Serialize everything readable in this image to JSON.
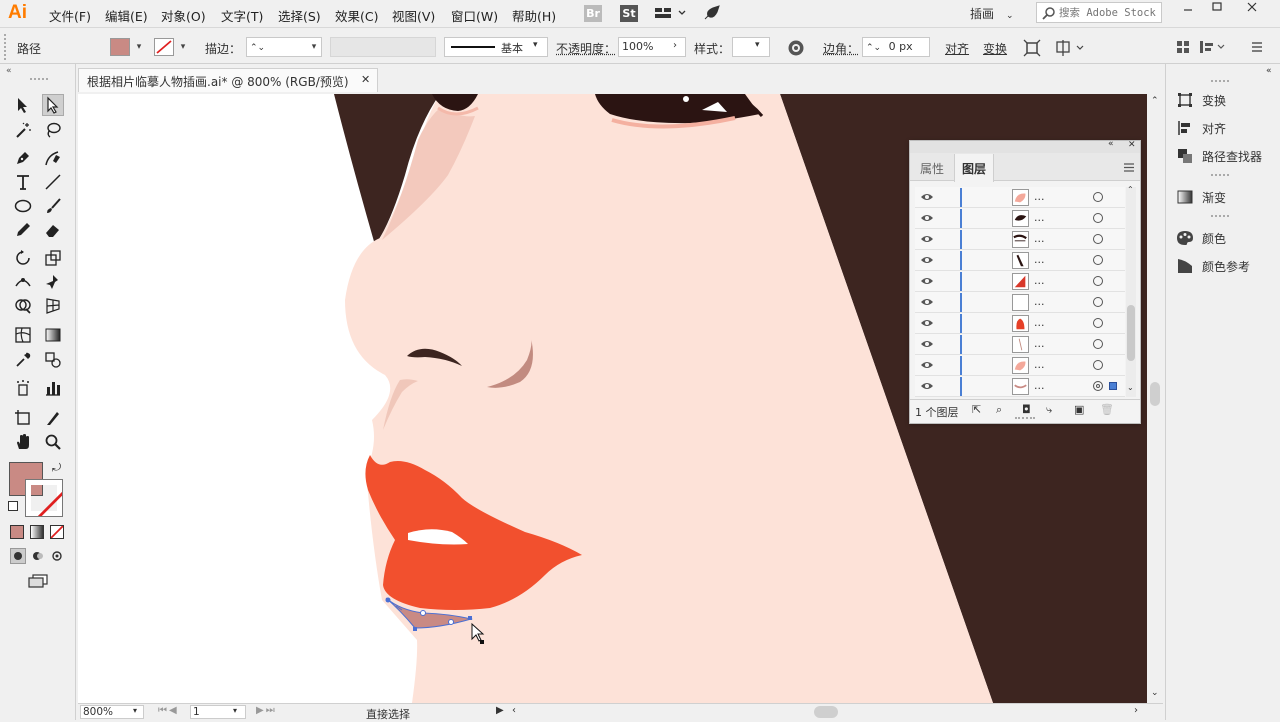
{
  "app": {
    "logo": "Ai"
  },
  "menu": {
    "items": [
      "文件(F)",
      "编辑(E)",
      "对象(O)",
      "文字(T)",
      "选择(S)",
      "效果(C)",
      "视图(V)",
      "窗口(W)",
      "帮助(H)"
    ],
    "br_label": "Br",
    "st_label": "St",
    "workspace": "插画",
    "search_placeholder": "搜索 Adobe Stock"
  },
  "control": {
    "selection_type": "路径",
    "stroke_label": "描边：",
    "stroke_style": "基本",
    "opacity_label": "不透明度：",
    "opacity_value": "100%",
    "style_label": "样式：",
    "corner_label": "边角：",
    "corner_value": "0 px",
    "align_label": "对齐",
    "transform_label": "变换",
    "fill_color": "#c98a84"
  },
  "document": {
    "tab_title": "根据相片临摹人物插画.ai* @ 800% (RGB/预览)",
    "zoom": "800%",
    "artboard": "1",
    "status_tool": "直接选择"
  },
  "layers_panel": {
    "tabs": [
      "属性",
      "图层"
    ],
    "active_tab": "图层",
    "row_label": "...",
    "footer": "1 个图层",
    "rows": [
      {
        "thumb": "pink-shape"
      },
      {
        "thumb": "black-leaf"
      },
      {
        "thumb": "eye-line"
      },
      {
        "thumb": "black-stroke"
      },
      {
        "thumb": "red-triangle"
      },
      {
        "thumb": "blank"
      },
      {
        "thumb": "red-lip"
      },
      {
        "thumb": "thin-line"
      },
      {
        "thumb": "pink-shape"
      },
      {
        "thumb": "lower-lip"
      }
    ]
  },
  "right_dock": {
    "items": [
      "变换",
      "对齐",
      "路径查找器",
      "渐变",
      "颜色",
      "颜色参考"
    ]
  },
  "colors": {
    "hair": "#3d2520",
    "skin": "#fde2d8",
    "lip": "#f2502e",
    "shadow": "#c28b80",
    "selection": "#4a6fd4",
    "selected_fill": "#c98a84"
  }
}
